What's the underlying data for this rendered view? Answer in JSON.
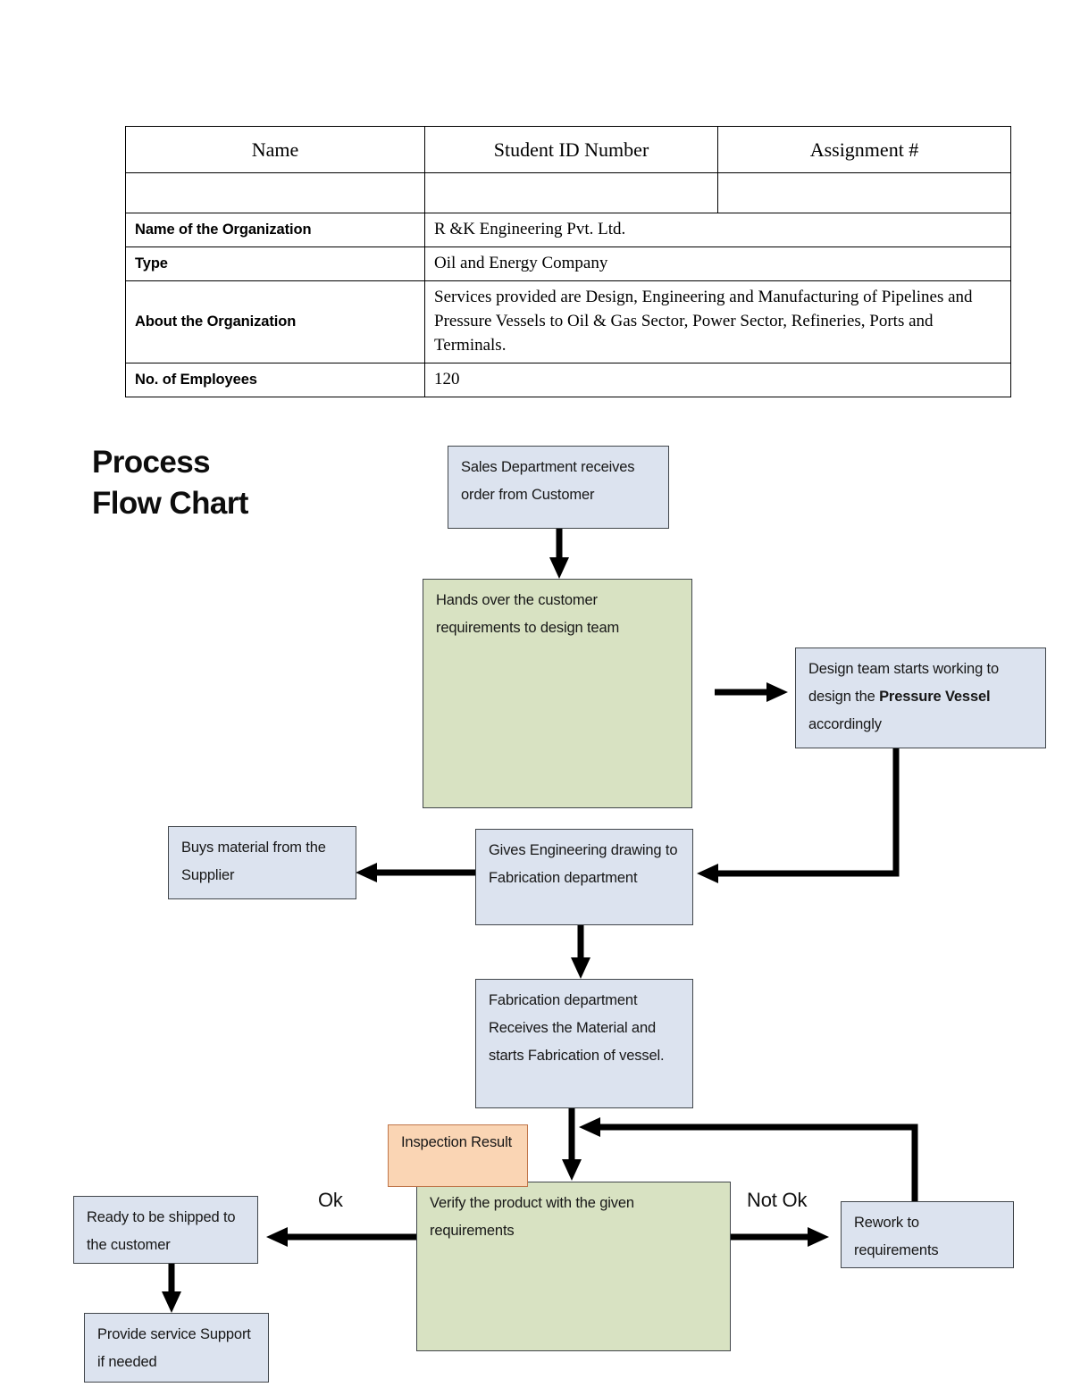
{
  "info_table": {
    "headers": [
      "Name",
      "Student ID Number",
      "Assignment #"
    ],
    "blank_row": [
      "",
      "",
      ""
    ],
    "rows": [
      {
        "label": "Name of the Organization",
        "value": "R &K Engineering Pvt. Ltd."
      },
      {
        "label": "Type",
        "value": "Oil and Energy Company"
      },
      {
        "label": "About the Organization",
        "value": "Services provided are Design, Engineering and Manufacturing of Pipelines and Pressure Vessels to Oil & Gas Sector, Power Sector, Refineries, Ports and Terminals."
      },
      {
        "label": "No. of Employees",
        "value": "120"
      }
    ]
  },
  "flowchart": {
    "title_line1": "Process",
    "title_line2": "Flow Chart",
    "colors": {
      "blue_fill": "#dce3ef",
      "green_fill": "#d8e2c2",
      "peach_fill": "#fad5b4",
      "border": "#41464b",
      "arrow": "#000000"
    },
    "nodes": {
      "sales": "Sales Department receives order from Customer",
      "hands_over": "Hands over the customer requirements to design team",
      "design_team_pre": "Design team starts working to design the ",
      "design_team_bold": "Pressure Vessel",
      "design_team_post": " accordingly",
      "buys_material": "Buys material from the Supplier",
      "gives_drawing": "Gives Engineering drawing to Fabrication department",
      "fabrication": "Fabrication department Receives the Material and starts Fabrication of vessel.",
      "inspection": "Inspection Result",
      "verify": "Verify the product with the given requirements",
      "ready_shipped": "Ready to be shipped to the customer",
      "provide_service": "Provide service Support if needed",
      "rework": "Rework to requirements"
    },
    "edge_labels": {
      "ok": "Ok",
      "not_ok": "Not Ok"
    }
  }
}
